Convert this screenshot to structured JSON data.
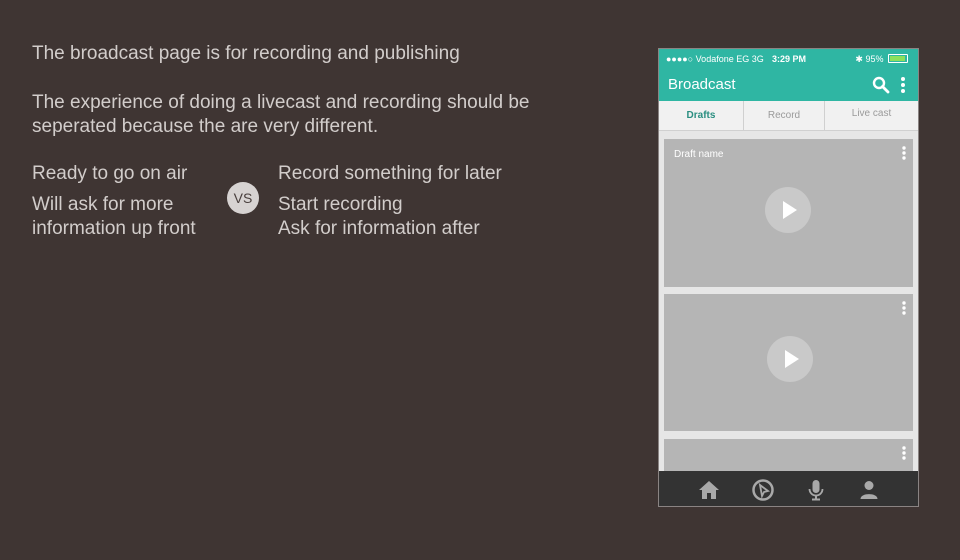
{
  "notes": {
    "line1": "The broadcast page is for recording and publishing",
    "line2": "The experience of doing a livecast and recording should be seperated because the are very different."
  },
  "compare": {
    "left_a": "Ready to go on air",
    "left_b_1": "Will ask for more",
    "left_b_2": "information up front",
    "vs": "VS",
    "right_a": "Record something for later",
    "right_b_1": "Start recording",
    "right_b_2": "Ask for information after"
  },
  "phone": {
    "status": {
      "carrier": "●●●●○ Vodafone EG  3G",
      "time": "3:29 PM",
      "battery": "95%",
      "battery_level": 0.95
    },
    "appbar": {
      "title": "Broadcast",
      "search_icon": "search-icon",
      "more_icon": "more-vert-icon"
    },
    "tabs": [
      "Drafts",
      "Record",
      "Live cast"
    ],
    "active_tab": 0,
    "cards": [
      {
        "name": "Draft name"
      },
      {
        "name": ""
      },
      {
        "name": ""
      }
    ],
    "nav_icons": [
      "home-icon",
      "compass-icon",
      "microphone-icon",
      "profile-icon"
    ]
  },
  "colors": {
    "background": "#3f3533",
    "accent": "#2fb6a3",
    "card": "#b5b5b5",
    "navbar": "#333333"
  }
}
